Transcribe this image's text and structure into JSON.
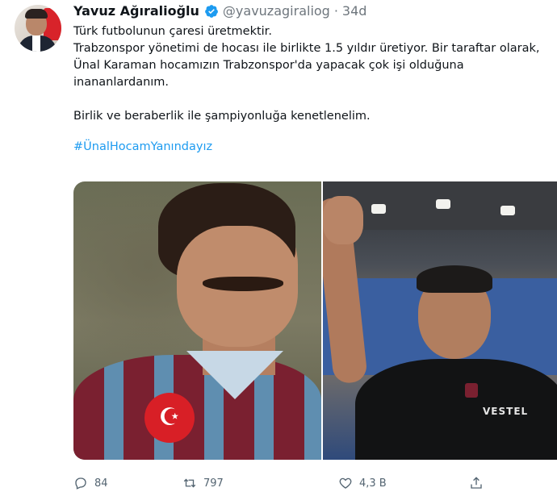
{
  "author": {
    "display_name": "Yavuz Ağıralioğlu",
    "handle": "@yavuzagiraliog",
    "time": "34d",
    "separator": "·",
    "verified_icon": "verified-badge-icon"
  },
  "tweet": {
    "lines": [
      "Türk futbolunun çaresi üretmektir.",
      "Trabzonspor yönetimi de hocası ile birlikte 1.5 yıldır üretiyor. Bir taraftar olarak, Ünal Karaman hocamızın Trabzonspor'da yapacak çok işi olduğuna inananlardanım."
    ],
    "line2": "Birlik ve beraberlik ile şampiyonluğa kenetlenelim.",
    "hashtag": "#ÜnalHocamYanındayız"
  },
  "media": {
    "left_crest_symbol": "☪",
    "right_logo_text": "VESTEL"
  },
  "actions": {
    "reply_count": "84",
    "retweet_count": "797",
    "like_count": "4,3 B",
    "icons": [
      "reply-icon",
      "retweet-icon",
      "like-icon",
      "share-icon"
    ]
  },
  "colors": {
    "link": "#1d9bf0",
    "muted": "#6e767d",
    "verified": "#1d9bf0"
  }
}
